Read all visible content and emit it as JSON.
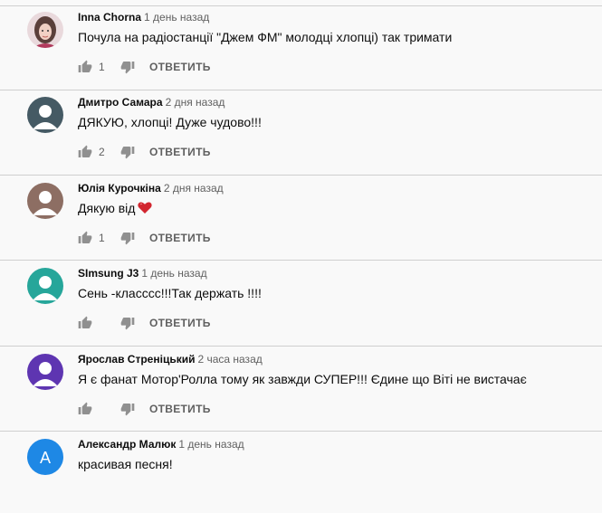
{
  "reply_label": "ОТВЕТИТЬ",
  "comments": [
    {
      "author": "Inna Chorna",
      "time": "1 день назад",
      "text": "Почула на радіостанції \"Джем ФМ\" молодці хлопці) так тримати",
      "likes": "1",
      "avatar": "photo-girl"
    },
    {
      "author": "Дмитро Самара",
      "time": "2 дня назад",
      "text": "ДЯКУЮ, хлопці! Дуже чудово!!!",
      "likes": "2",
      "avatar": "default-person"
    },
    {
      "author": "Юлія Курочкіна",
      "time": "2 дня назад",
      "text": "Дякую від",
      "likes": "1",
      "avatar": "default-person",
      "emoji": "heart"
    },
    {
      "author": "SImsung J3",
      "time": "1 день назад",
      "text": "Сень -класссс!!!Так держать !!!!",
      "likes": "",
      "avatar": "default-person"
    },
    {
      "author": "Ярослав Стреніцький",
      "time": "2 часа назад",
      "text": "Я є фанат Мотор'Ролла тому як завжди СУПЕР!!! Єдине що Віті не вистачає",
      "likes": "",
      "avatar": "default-person"
    },
    {
      "author": "Александр Малюк",
      "time": "1 день назад",
      "text": "красивая песня!",
      "likes": "",
      "avatar": "letter",
      "avatar_letter": "А"
    }
  ],
  "avatar_colors": [
    "#d8a5a8",
    "#455a64",
    "#8d6e63",
    "#26a69a",
    "#5e35b1",
    "#1e88e5"
  ]
}
